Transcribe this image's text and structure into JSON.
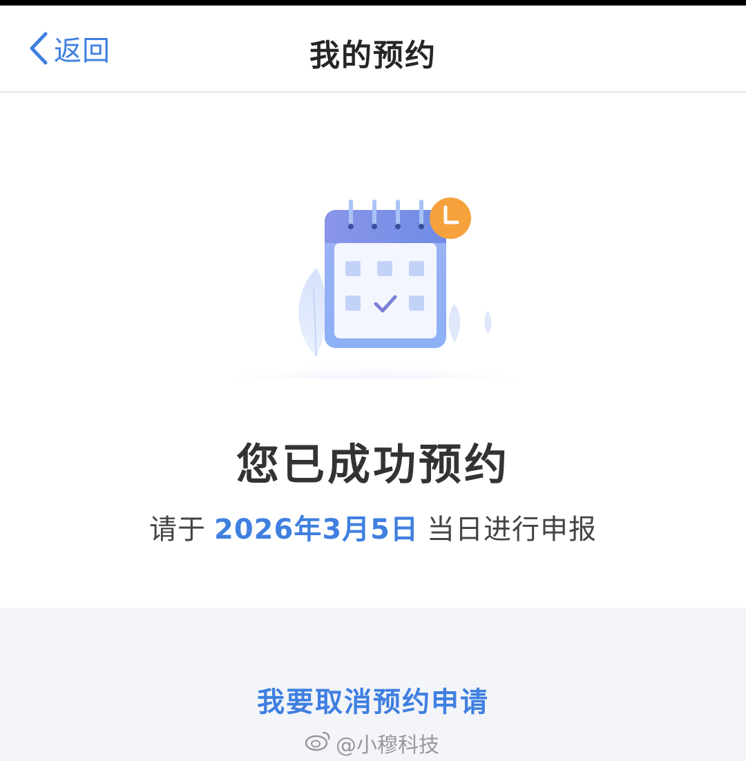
{
  "header": {
    "back_label": "返回",
    "title": "我的预约"
  },
  "result": {
    "success_text": "您已成功预约",
    "info_prefix": "请于",
    "date": "2026年3月5日",
    "info_suffix": "当日进行申报"
  },
  "actions": {
    "cancel_label": "我要取消预约申请"
  },
  "watermark": {
    "text": "@小穆科技"
  },
  "colors": {
    "accent": "#3f7fe0",
    "calendar_top": "#7e8fe6",
    "clock_badge": "#f6a23c",
    "bottom_bg": "#f3f5f9"
  },
  "icons": [
    "chevron-left-icon",
    "calendar-icon",
    "clock-icon",
    "check-icon",
    "weibo-icon"
  ]
}
